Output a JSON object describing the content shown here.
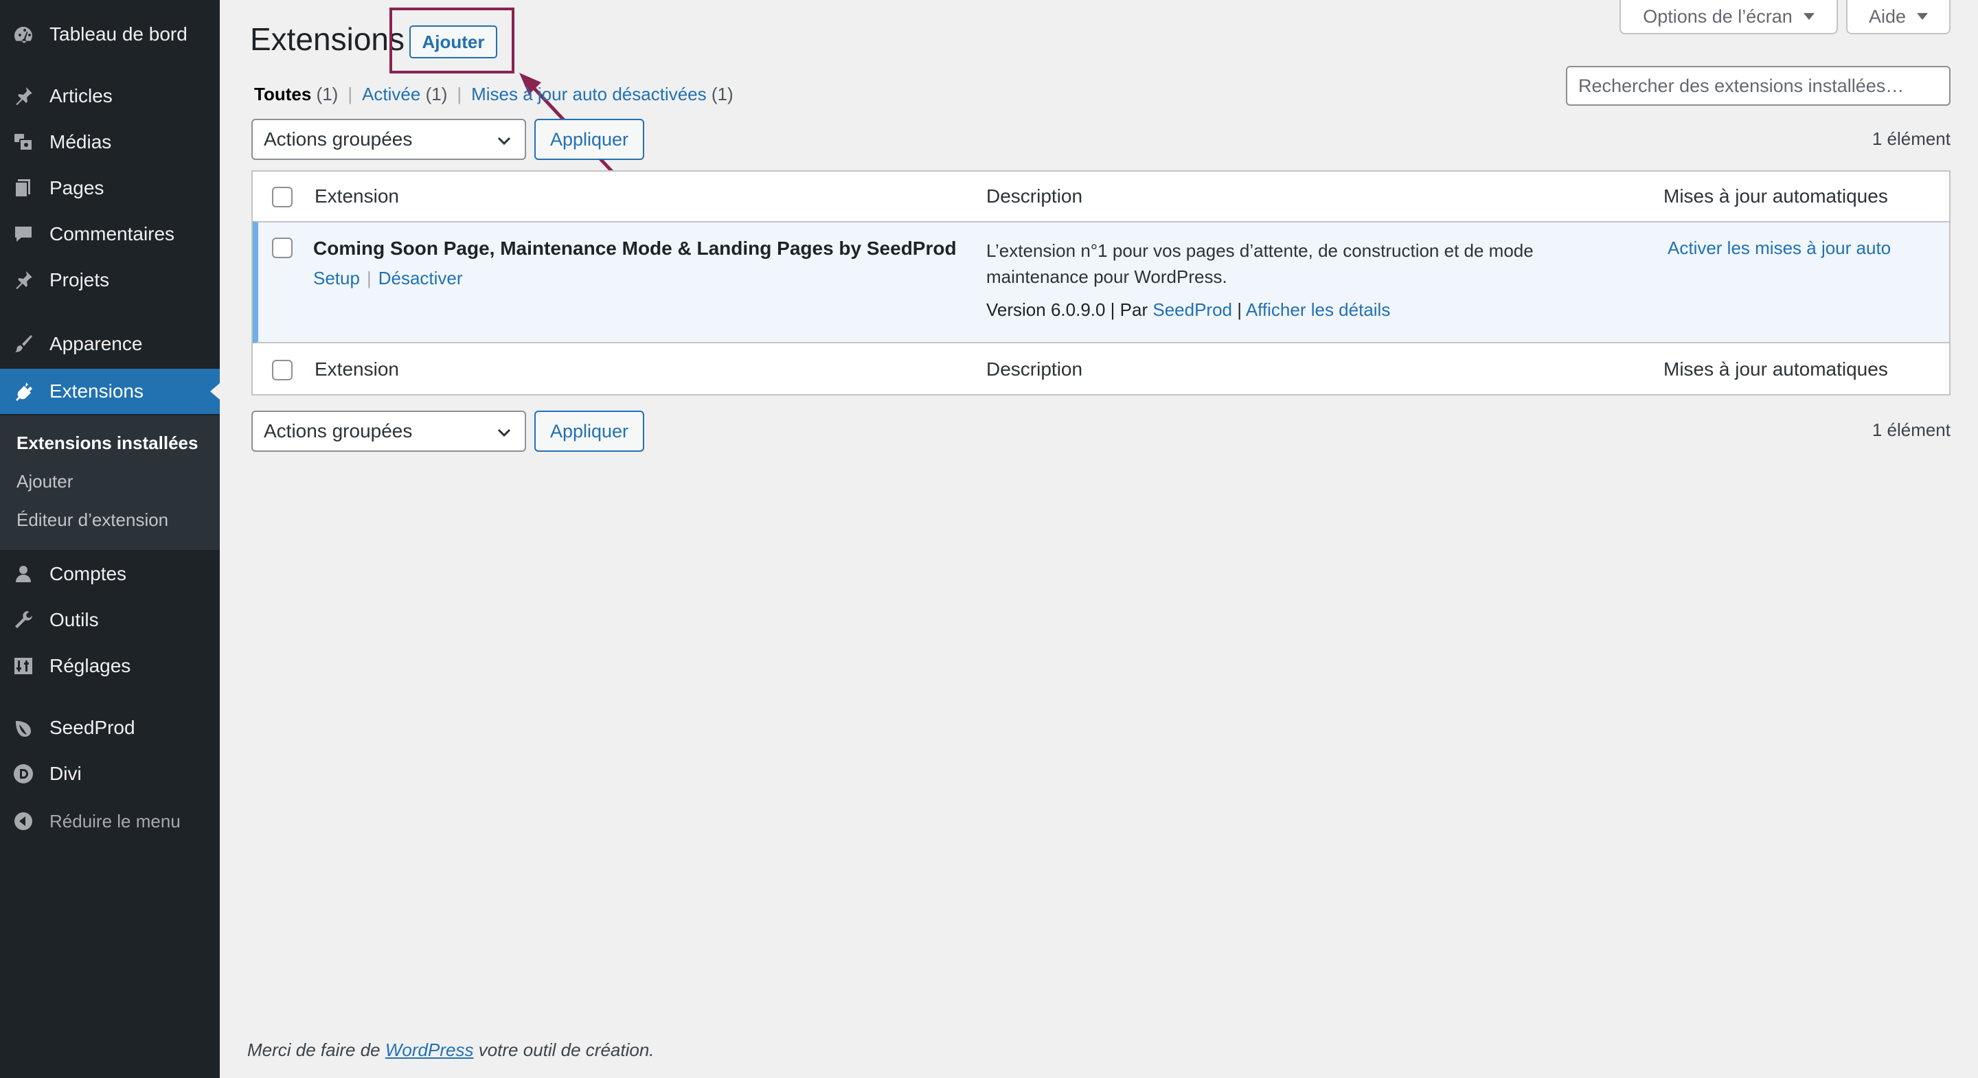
{
  "sidebar": {
    "items": [
      {
        "label": "Tableau de bord",
        "icon": "dashboard-icon"
      },
      {
        "label": "Articles",
        "icon": "pin-icon"
      },
      {
        "label": "Médias",
        "icon": "media-icon"
      },
      {
        "label": "Pages",
        "icon": "pages-icon"
      },
      {
        "label": "Commentaires",
        "icon": "comments-icon"
      },
      {
        "label": "Projets",
        "icon": "pin-icon"
      },
      {
        "label": "Apparence",
        "icon": "brush-icon"
      },
      {
        "label": "Extensions",
        "icon": "plugin-icon"
      },
      {
        "label": "Comptes",
        "icon": "users-icon"
      },
      {
        "label": "Outils",
        "icon": "wrench-icon"
      },
      {
        "label": "Réglages",
        "icon": "settings-icon"
      },
      {
        "label": "SeedProd",
        "icon": "seedprod-icon"
      },
      {
        "label": "Divi",
        "icon": "divi-icon"
      }
    ],
    "submenu": [
      "Extensions installées",
      "Ajouter",
      "Éditeur d’extension"
    ],
    "collapse_label": "Réduire le menu"
  },
  "top": {
    "screen_options": "Options de l’écran",
    "help": "Aide"
  },
  "header": {
    "title": "Extensions",
    "add_label": "Ajouter"
  },
  "filters": [
    {
      "label": "Toutes",
      "count": "(1)"
    },
    {
      "label": "Activée",
      "count": "(1)"
    },
    {
      "label": "Mises à jour auto désactivées",
      "count": "(1)"
    }
  ],
  "search": {
    "placeholder": "Rechercher des extensions installées…"
  },
  "bulk": {
    "select_label": "Actions groupées",
    "apply_label": "Appliquer",
    "count": "1 élément"
  },
  "table": {
    "headers": [
      "Extension",
      "Description",
      "Mises à jour automatiques"
    ],
    "plugin": {
      "name": "Coming Soon Page, Maintenance Mode & Landing Pages by SeedProd",
      "actions": [
        "Setup",
        "Désactiver"
      ],
      "description": "L’extension n°1 pour vos pages d’attente, de construction et de mode maintenance pour WordPress.",
      "version_text": "Version 6.0.9.0 | Par",
      "author": "SeedProd",
      "details_sep": "|",
      "details": "Afficher les détails",
      "auto_update": "Activer les mises à jour auto"
    }
  },
  "footer": {
    "prefix": "Merci de faire de",
    "link": "WordPress",
    "suffix": "votre outil de création."
  },
  "colors": {
    "accent": "#2271b1",
    "sidebar": "#1d2327",
    "highlight": "#8a2451"
  }
}
